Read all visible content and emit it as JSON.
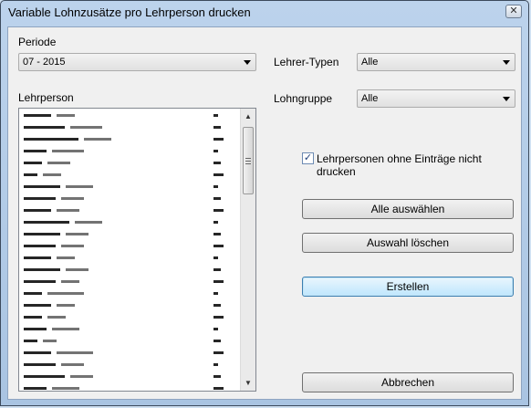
{
  "window": {
    "title": "Variable Lohnzusätze pro Lehrperson drucken",
    "close_glyph": "✕"
  },
  "periode": {
    "label": "Periode",
    "value": "07 - 2015"
  },
  "lehrperson": {
    "label": "Lehrperson"
  },
  "lehrer_typen": {
    "label": "Lehrer-Typen",
    "value": "Alle"
  },
  "lohngruppe": {
    "label": "Lohngruppe",
    "value": "Alle"
  },
  "checkbox": {
    "label": "Lehrpersonen ohne Einträge nicht drucken",
    "checked": true,
    "glyph": "✓"
  },
  "buttons": {
    "alle_auswaehlen": "Alle auswählen",
    "auswahl_loeschen": "Auswahl löschen",
    "erstellen": "Erstellen",
    "abbrechen": "Abbrechen"
  },
  "scrollbar": {
    "up_glyph": "▲",
    "down_glyph": "▼"
  }
}
